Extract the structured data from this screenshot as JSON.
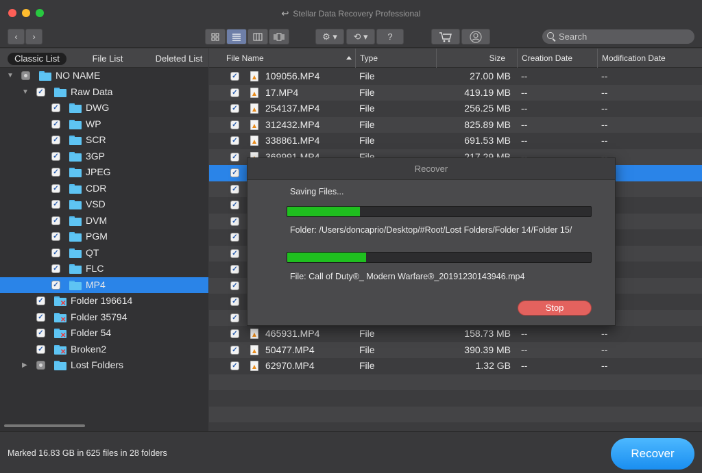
{
  "app": {
    "title": "Stellar Data Recovery Professional"
  },
  "toolbar": {
    "back_icon": "chevron-left",
    "forward_icon": "chevron-right",
    "view_icons": [
      "grid-view-icon",
      "list-view-icon",
      "column-view-icon",
      "coverflow-view-icon"
    ],
    "selected_view": "list",
    "settings_icon": "gear",
    "history_icon": "clock-arrow",
    "help_label": "?",
    "cart_icon": "cart",
    "account_icon": "user",
    "search_placeholder": "Search"
  },
  "left": {
    "tabs": [
      {
        "label": "Classic List",
        "active": true
      },
      {
        "label": "File List",
        "active": false
      },
      {
        "label": "Deleted List",
        "active": false
      }
    ],
    "tree": [
      {
        "label": "NO NAME",
        "expanded": true,
        "checked": "partial"
      },
      {
        "label": "Raw Data",
        "expanded": true,
        "checked": "checked"
      },
      {
        "label": "DWG",
        "checked": "checked"
      },
      {
        "label": "WP",
        "checked": "checked"
      },
      {
        "label": "SCR",
        "checked": "checked"
      },
      {
        "label": "3GP",
        "checked": "checked"
      },
      {
        "label": "JPEG",
        "checked": "checked"
      },
      {
        "label": "CDR",
        "checked": "checked"
      },
      {
        "label": "VSD",
        "checked": "checked"
      },
      {
        "label": "DVM",
        "checked": "checked"
      },
      {
        "label": "PGM",
        "checked": "checked"
      },
      {
        "label": "QT",
        "checked": "checked"
      },
      {
        "label": "FLC",
        "checked": "checked"
      },
      {
        "label": "MP4",
        "checked": "checked",
        "selected": true
      },
      {
        "label": "Folder 196614",
        "checked": "checked",
        "deleted": true
      },
      {
        "label": "Folder 35794",
        "checked": "checked",
        "deleted": true
      },
      {
        "label": "Folder 54",
        "checked": "checked",
        "deleted": true
      },
      {
        "label": "Broken2",
        "checked": "checked",
        "deleted": true
      },
      {
        "label": "Lost Folders",
        "expanded": false,
        "checked": "partial"
      }
    ]
  },
  "table": {
    "columns": [
      "File Name",
      "Type",
      "Size",
      "Creation Date",
      "Modification Date"
    ],
    "rows": [
      {
        "name": "109056.MP4",
        "type": "File",
        "size": "27.00 MB",
        "created": "--",
        "modified": "--"
      },
      {
        "name": "17.MP4",
        "type": "File",
        "size": "419.19 MB",
        "created": "--",
        "modified": "--"
      },
      {
        "name": "254137.MP4",
        "type": "File",
        "size": "256.25 MB",
        "created": "--",
        "modified": "--"
      },
      {
        "name": "312432.MP4",
        "type": "File",
        "size": "825.89 MB",
        "created": "--",
        "modified": "--"
      },
      {
        "name": "338861.MP4",
        "type": "File",
        "size": "691.53 MB",
        "created": "--",
        "modified": "--"
      },
      {
        "name": "369991.MP4",
        "type": "File",
        "size": "217.29 MB",
        "created": "--",
        "modified": "--"
      },
      {
        "name": "",
        "type": "",
        "size": "",
        "created": "",
        "modified": "",
        "highlight": true
      },
      {
        "name": "",
        "type": "",
        "size": "",
        "created": "",
        "modified": ""
      },
      {
        "name": "",
        "type": "",
        "size": "",
        "created": "",
        "modified": ""
      },
      {
        "name": "",
        "type": "",
        "size": "",
        "created": "",
        "modified": ""
      },
      {
        "name": "",
        "type": "",
        "size": "",
        "created": "",
        "modified": ""
      },
      {
        "name": "",
        "type": "",
        "size": "",
        "created": "",
        "modified": ""
      },
      {
        "name": "",
        "type": "",
        "size": "",
        "created": "",
        "modified": ""
      },
      {
        "name": "",
        "type": "",
        "size": "",
        "created": "",
        "modified": ""
      },
      {
        "name": "",
        "type": "",
        "size": "",
        "created": "",
        "modified": ""
      },
      {
        "name": "",
        "type": "",
        "size": "",
        "created": "",
        "modified": ""
      },
      {
        "name": "465931.MP4",
        "type": "File",
        "size": "158.73 MB",
        "created": "--",
        "modified": "--"
      },
      {
        "name": "50477.MP4",
        "type": "File",
        "size": "390.39 MB",
        "created": "--",
        "modified": "--"
      },
      {
        "name": "62970.MP4",
        "type": "File",
        "size": "1.32 GB",
        "created": "--",
        "modified": "--"
      }
    ]
  },
  "dialog": {
    "title": "Recover",
    "status": "Saving Files...",
    "folder_progress": 0.24,
    "folder_text": "Folder: /Users/doncaprio/Desktop/#Root/Lost Folders/Folder 14/Folder 15/",
    "file_progress": 0.26,
    "file_text": "File: Call of Duty®_ Modern Warfare®_2019123014 3946.mp4",
    "stop_label": "Stop"
  },
  "status": {
    "text": "Marked 16.83 GB in 625 files in 28 folders",
    "recover_label": "Recover"
  }
}
